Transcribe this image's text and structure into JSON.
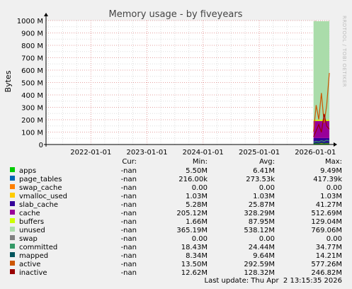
{
  "chart_data": {
    "type": "area",
    "title": "Memory usage - by fiveyears",
    "ylabel": "Bytes",
    "side_label": "RRDTOOL / TOBI OETIKER",
    "y_ticks": [
      "0",
      "100 M",
      "200 M",
      "300 M",
      "400 M",
      "500 M",
      "600 M",
      "700 M",
      "800 M",
      "900 M",
      "1000 M"
    ],
    "ylim": [
      0,
      1000
    ],
    "y_unit": "M",
    "x_ticks": [
      "2022-01-01",
      "2023-01-01",
      "2024-01-01",
      "2025-01-01",
      "2026-01-01"
    ],
    "x_tick_years": [
      2022,
      2023,
      2024,
      2025,
      2026
    ],
    "xlim": [
      "2021-03-15",
      "2026-04-02"
    ],
    "x_minor_months": [
      "2021-04-01",
      "2021-07-01",
      "2021-10-01",
      "2022-04-01",
      "2022-07-01",
      "2022-10-01",
      "2023-04-01",
      "2023-07-01",
      "2023-10-01",
      "2024-04-01",
      "2024-07-01",
      "2024-10-01",
      "2025-04-01",
      "2025-07-01",
      "2025-10-01",
      "2026-04-01"
    ],
    "data_window": [
      "2025-12-20",
      "2026-04-02"
    ],
    "stack": [
      {
        "name": "apps",
        "color": "#00cc00",
        "top": 9.5
      },
      {
        "name": "page_tables",
        "color": "#0066b3",
        "top": 9.9
      },
      {
        "name": "swap_cache",
        "color": "#ff8000",
        "top": 9.9
      },
      {
        "name": "vmalloc_used",
        "color": "#ffcc00",
        "top": 10.9
      },
      {
        "name": "slab_cache",
        "color": "#330099",
        "top": 52
      },
      {
        "name": "cache",
        "color": "#990099",
        "top": 190
      },
      {
        "name": "buffers",
        "color": "#ccff00",
        "top": 200
      },
      {
        "name": "unused",
        "color": "#aadcaa",
        "top": 995
      }
    ],
    "lines": [
      {
        "name": "committed",
        "color": "#339966",
        "value": 34.77
      },
      {
        "name": "mapped",
        "color": "#00545c",
        "value": 14.21
      },
      {
        "name": "active",
        "color": "#cc5500",
        "value": 577.26
      },
      {
        "name": "inactive",
        "color": "#990000",
        "value": 246.82
      }
    ],
    "legend_headers": {
      "cur": "Cur:",
      "min": "Min:",
      "avg": "Avg:",
      "max": "Max:"
    },
    "legend": [
      {
        "name": "apps",
        "color": "#00cc00",
        "cur": "-nan",
        "min": "5.50M",
        "avg": "6.41M",
        "max": "9.49M"
      },
      {
        "name": "page_tables",
        "color": "#0066b3",
        "cur": "-nan",
        "min": "216.00k",
        "avg": "273.53k",
        "max": "417.39k"
      },
      {
        "name": "swap_cache",
        "color": "#ff8000",
        "cur": "-nan",
        "min": "0.00",
        "avg": "0.00",
        "max": "0.00"
      },
      {
        "name": "vmalloc_used",
        "color": "#ffcc00",
        "cur": "-nan",
        "min": "1.03M",
        "avg": "1.03M",
        "max": "1.03M"
      },
      {
        "name": "slab_cache",
        "color": "#330099",
        "cur": "-nan",
        "min": "5.28M",
        "avg": "25.87M",
        "max": "41.27M"
      },
      {
        "name": "cache",
        "color": "#990099",
        "cur": "-nan",
        "min": "205.12M",
        "avg": "328.29M",
        "max": "512.69M"
      },
      {
        "name": "buffers",
        "color": "#ccff00",
        "cur": "-nan",
        "min": "1.66M",
        "avg": "87.95M",
        "max": "129.04M"
      },
      {
        "name": "unused",
        "color": "#aadcaa",
        "cur": "-nan",
        "min": "365.19M",
        "avg": "538.12M",
        "max": "769.06M"
      },
      {
        "name": "swap",
        "color": "#808080",
        "cur": "-nan",
        "min": "0.00",
        "avg": "0.00",
        "max": "0.00"
      },
      {
        "name": "committed",
        "color": "#339966",
        "cur": "-nan",
        "min": "18.43M",
        "avg": "24.44M",
        "max": "34.77M"
      },
      {
        "name": "mapped",
        "color": "#00545c",
        "cur": "-nan",
        "min": "8.34M",
        "avg": "9.64M",
        "max": "14.21M"
      },
      {
        "name": "active",
        "color": "#cc5500",
        "cur": "-nan",
        "min": "13.50M",
        "avg": "292.59M",
        "max": "577.26M"
      },
      {
        "name": "inactive",
        "color": "#990000",
        "cur": "-nan",
        "min": "12.62M",
        "avg": "128.32M",
        "max": "246.82M"
      }
    ],
    "last_update": "Last update: Thu Apr  2 13:15:35 2026",
    "grid": true,
    "colors": {
      "background": "#f0f0f0",
      "plot_background": "#ffffff",
      "major_grid": "#e5a0a0",
      "minor_grid": "#dddddd",
      "axis": "#000000"
    }
  }
}
